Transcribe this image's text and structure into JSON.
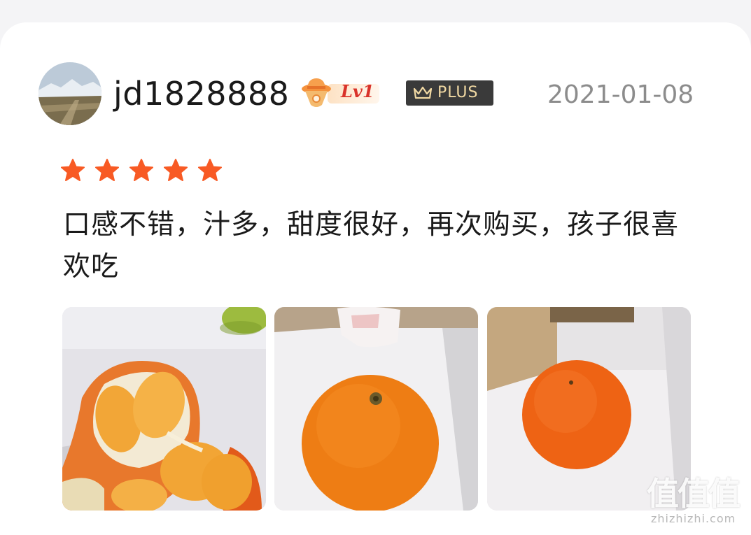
{
  "review": {
    "username": "jd1828888",
    "level_label": "Lv1",
    "plus_label": "PLUS",
    "date": "2021-01-08",
    "rating": 5,
    "rating_max": 5,
    "text": "口感不错，汁多，甜度很好，再次购买，孩子很喜欢吃",
    "photo_count": 3
  },
  "watermark": {
    "logo": "值值值",
    "url": "zhizhizhi.com"
  },
  "colors": {
    "star": "#f85a24",
    "date": "#8c8c8c",
    "plus_badge_bg": "#3a3a3a",
    "plus_text": "#f1d9a3",
    "level_text": "#d9322a"
  },
  "icons": {
    "avatar": "avatar-photo",
    "level": "cowboy-hat-level-icon",
    "plus": "crown-icon",
    "star": "star-icon"
  }
}
